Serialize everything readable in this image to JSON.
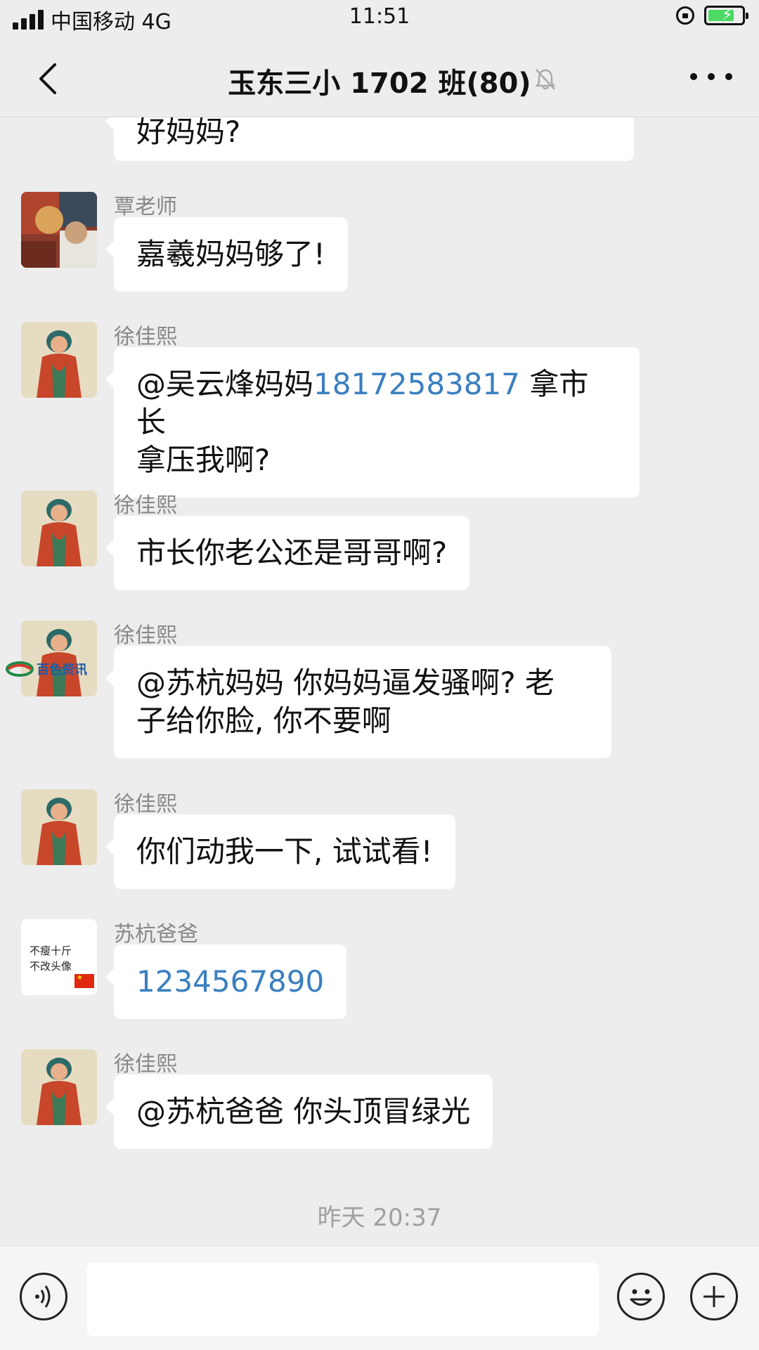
{
  "status": {
    "carrier": "中国移动 4G",
    "time": "11:51"
  },
  "header": {
    "title": "玉东三小 1702 班(80)"
  },
  "messages": [
    {
      "text": "好妈妈?"
    },
    {
      "sender": "覃老师",
      "text": "嘉羲妈妈够了!"
    },
    {
      "sender": "徐佳熙",
      "prefix": "@吴云烽妈妈",
      "number": "18172583817",
      "suffix": " 拿市长",
      "line2": "拿压我啊?"
    },
    {
      "sender": "徐佳熙",
      "text": "市长你老公还是哥哥啊?"
    },
    {
      "sender": "徐佳熙",
      "line1": "@苏杭妈妈 你妈妈逼发骚啊? 老",
      "line2": "子给你脸, 你不要啊"
    },
    {
      "sender": "徐佳熙",
      "text": "你们动我一下, 试试看!"
    },
    {
      "sender": "苏杭爸爸",
      "text": "1234567890",
      "avatar_text_1": "不瘦十斤",
      "avatar_text_2": "不改头像"
    },
    {
      "sender": "徐佳熙",
      "text": "@苏杭爸爸 你头顶冒绿光"
    }
  ],
  "timestamp": "昨天 20:37",
  "watermark": "百色资讯"
}
